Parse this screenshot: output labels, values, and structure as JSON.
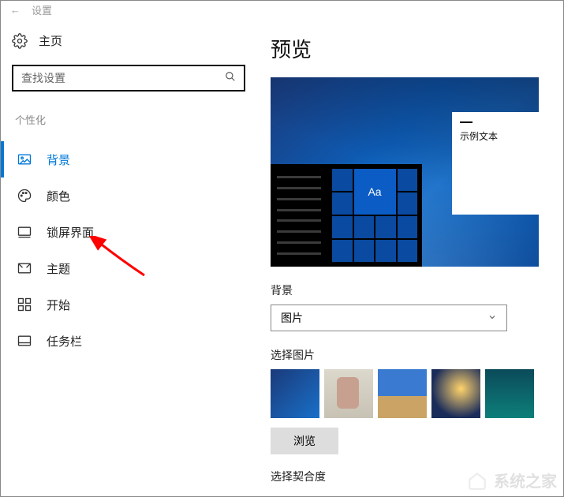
{
  "topbar": {
    "back": "←",
    "title": "设置"
  },
  "sidebar": {
    "home": "主页",
    "search_placeholder": "查找设置",
    "section": "个性化",
    "items": [
      {
        "key": "background",
        "label": "背景",
        "active": true
      },
      {
        "key": "colors",
        "label": "颜色"
      },
      {
        "key": "lockscreen",
        "label": "锁屏界面"
      },
      {
        "key": "themes",
        "label": "主题"
      },
      {
        "key": "start",
        "label": "开始"
      },
      {
        "key": "taskbar",
        "label": "任务栏"
      }
    ]
  },
  "main": {
    "preview_title": "预览",
    "tile_text": "Aa",
    "sample_text": "示例文本",
    "bg_label": "背景",
    "bg_dropdown_value": "图片",
    "choose_label": "选择图片",
    "browse_button": "浏览",
    "fit_label": "选择契合度"
  },
  "watermark": "系统之家"
}
